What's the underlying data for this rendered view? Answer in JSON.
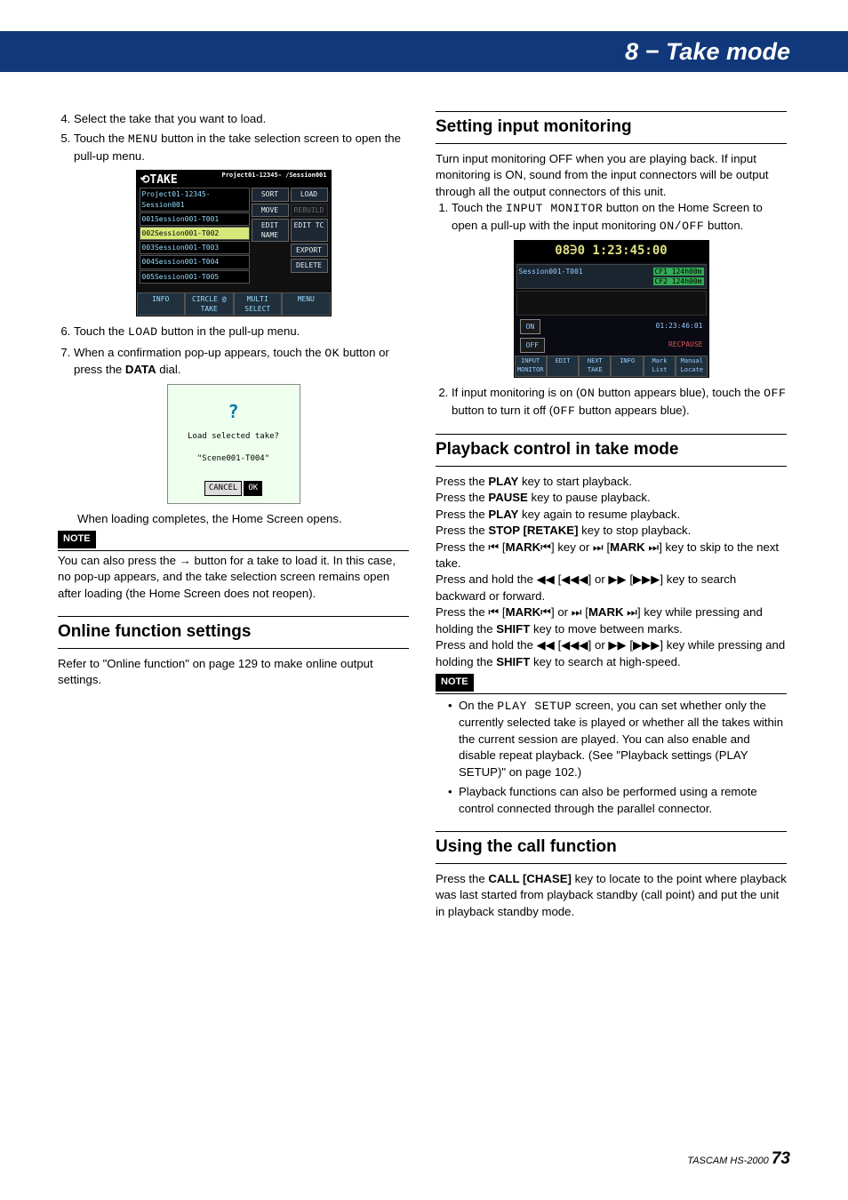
{
  "header": {
    "chapter_title": "8 − Take mode"
  },
  "left": {
    "step4": "Select the take that you want to load.",
    "step5_a": "Touch the ",
    "step5_menu": "MENU",
    "step5_b": " button in the take selection screen to open the pull-up menu.",
    "ss1": {
      "title_left": "⟲TAKE",
      "title_right": "Project01-12345-\n/Session001",
      "proj": "Project01-12345-\nSession001",
      "rows": [
        "001Session001-T001",
        "002Session001-T002",
        "003Session001-T003",
        "004Session001-T004",
        "005Session001-T005"
      ],
      "side": [
        "SORT",
        "LOAD",
        "MOVE",
        "REBUILD",
        "EDIT NAME",
        "EDIT TC",
        "EXPORT",
        "DELETE"
      ],
      "bottom": [
        "INFO",
        "CIRCLE @ TAKE",
        "MULTI SELECT",
        "MENU"
      ]
    },
    "step6_a": "Touch the ",
    "step6_load": "LOAD",
    "step6_b": " button in the pull-up menu.",
    "step7_a": "When a confirmation pop-up appears, touch the ",
    "step7_ok": "OK",
    "step7_b": " button or press the ",
    "step7_data": "DATA",
    "step7_c": " dial.",
    "ss2": {
      "q": "?",
      "line1": "Load selected take?",
      "line2": "\"Scene001-T004\"",
      "cancel": "CANCEL",
      "ok": "OK"
    },
    "loadcomplete": "When loading completes, the Home Screen opens.",
    "note_label": "NOTE",
    "note_body_a": "You can also press the ",
    "note_body_b": " button for a take to load it. In this case, no pop-up appears, and the take selection screen remains open after loading (the Home Screen does not reopen).",
    "h_online": "Online function settings",
    "online_body": "Refer to \"Online function\" on page 129 to make online output settings."
  },
  "right": {
    "h_setting": "Setting input monitoring",
    "set_intro": "Turn input monitoring OFF when you are playing back. If input monitoring is ON, sound from the input connectors will be output through all the output connectors of this unit.",
    "set1_a": "Touch the ",
    "set1_btn": "INPUT MONITOR",
    "set1_b": " button on the Home Screen to open a pull-up with the input monitoring ",
    "set1_onoff": "ON/OFF",
    "set1_c": " button.",
    "ss3": {
      "tc": "08∋0 1:23:45:00",
      "sess": "Session001-T001",
      "cf1": "CF1 124h00m",
      "cf2": "CF2 124h00m",
      "tc2": "01:23:46:01",
      "rec": "RECPAUSE",
      "on": "ON",
      "off": "OFF",
      "bottom": [
        "INPUT MONITOR",
        "EDIT",
        "NEXT TAKE",
        "INFO",
        "Mark List",
        "Manual Locate"
      ]
    },
    "set2_a": "If input monitoring is on (",
    "set2_on": "ON",
    "set2_b": " button appears blue), touch the ",
    "set2_off1": "OFF",
    "set2_c": " button to turn it off (",
    "set2_off2": "OFF",
    "set2_d": " button appears blue).",
    "h_play": "Playback control in take mode",
    "play_l1_a": "Press the ",
    "play_l1_b": "PLAY",
    "play_l1_c": " key to start playback.",
    "play_l2_a": "Press the ",
    "play_l2_b": "PAUSE",
    "play_l2_c": " key to pause playback.",
    "play_l3_a": "Press the ",
    "play_l3_b": "PLAY",
    "play_l3_c": " key again to resume playback.",
    "play_l4_a": "Press the ",
    "play_l4_b": "STOP [RETAKE]",
    "play_l4_c": " key to stop playback.",
    "play_l5_a": "Press the ⏮ [",
    "play_l5_b": "MARK",
    "play_l5_c": "⏮] key or ⏭ [",
    "play_l5_d": "MARK",
    "play_l5_e": " ⏭] key to skip to the next take.",
    "play_l6": "Press and hold the ◀◀ [◀◀◀] or ▶▶ [▶▶▶] key to search backward or forward.",
    "play_l7_a": "Press the ⏮ [",
    "play_l7_b": "MARK",
    "play_l7_c": "⏮] or ⏭ [",
    "play_l7_d": "MARK",
    "play_l7_e": " ⏭] key while pressing and holding the ",
    "play_l7_f": "SHIFT",
    "play_l7_g": " key to move between marks.",
    "play_l8_a": "Press and hold the  ◀◀ [◀◀◀] or ▶▶ [▶▶▶] key while pressing and holding the ",
    "play_l8_b": "SHIFT",
    "play_l8_c": " key to search at high-speed.",
    "note_label": "NOTE",
    "bullet1_a": "On the ",
    "bullet1_ps": "PLAY SETUP",
    "bullet1_b": " screen, you can set whether only the currently selected take is played or whether all the takes within the current session are played. You can also enable and disable repeat playback. (See \"Playback settings (PLAY SETUP)\" on page 102.)",
    "bullet2": "Playback functions can also be performed using a remote control connected through the parallel connector.",
    "h_call": "Using the call function",
    "call_body_a": "Press the ",
    "call_body_b": "CALL [CHASE]",
    "call_body_c": " key to locate to the point where playback was last started from playback standby (call point) and put the unit in playback standby mode."
  },
  "footer": {
    "model": "TASCAM  HS-2000",
    "page": "73"
  }
}
